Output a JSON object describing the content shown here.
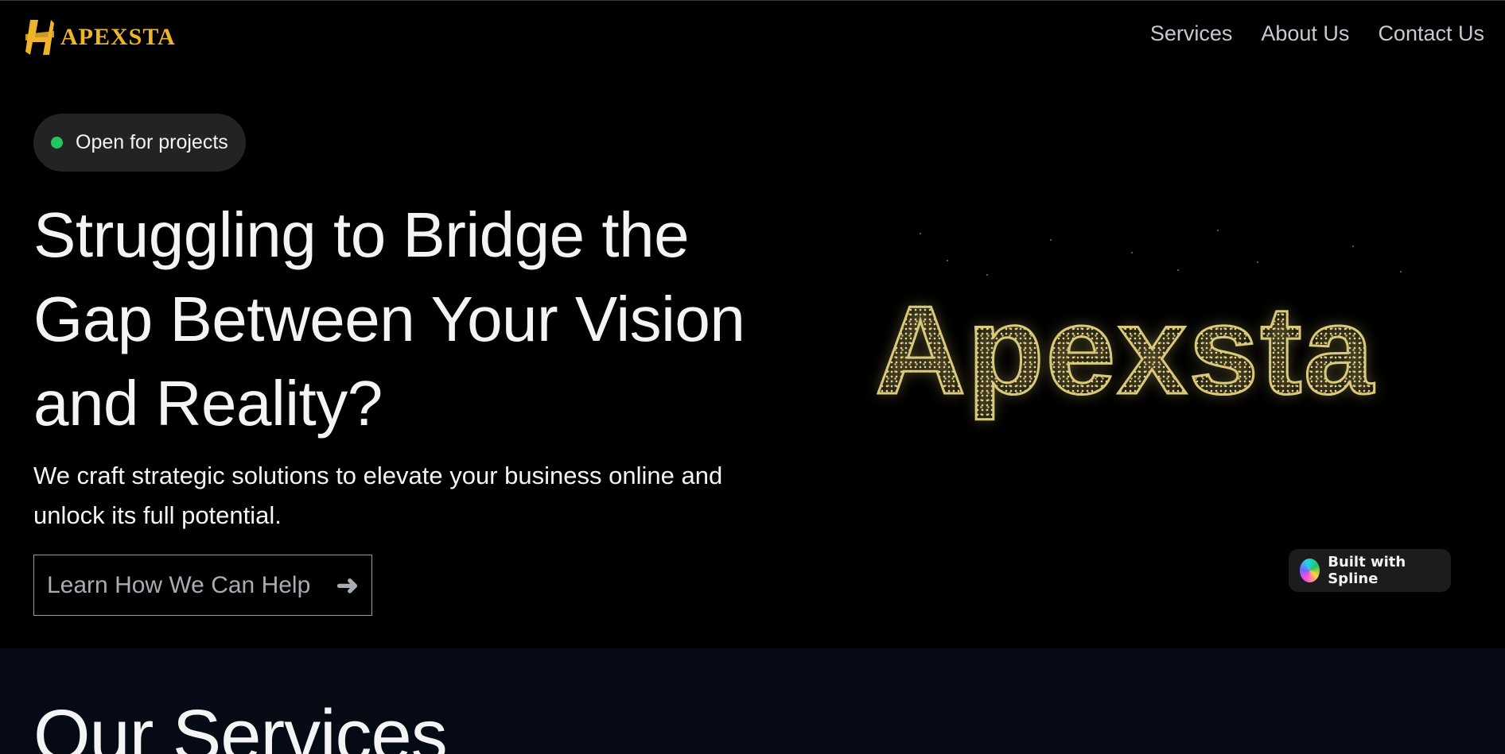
{
  "header": {
    "logo_text": "APEXSTA",
    "nav": [
      {
        "label": "Services"
      },
      {
        "label": "About Us"
      },
      {
        "label": "Contact Us"
      }
    ]
  },
  "hero": {
    "status_label": "Open for projects",
    "status_color": "#22c55e",
    "headline": "Struggling to Bridge the Gap Between Your Vision and Reality?",
    "subline": "We craft strategic solutions to elevate your business online and unlock its full potential.",
    "cta_label": "Learn How We Can Help",
    "scene_word": "Apexsta",
    "spline_badge": "Built with Spline"
  },
  "services": {
    "title": "Our Services"
  },
  "colors": {
    "brand_gold": "#f0b429",
    "background": "#000000",
    "section_bg": "#060a14"
  }
}
